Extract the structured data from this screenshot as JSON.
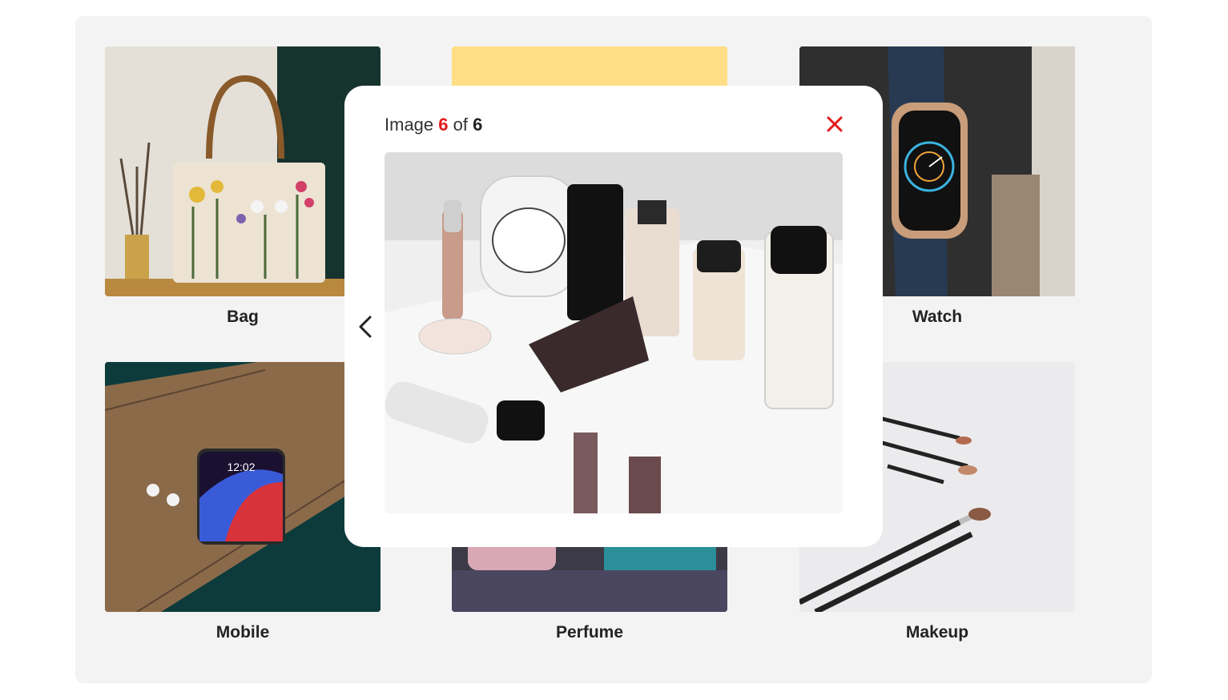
{
  "gallery": {
    "items": [
      {
        "label": "Bag",
        "icon": "bag-photo"
      },
      {
        "label": "",
        "icon": "food-photo"
      },
      {
        "label": "Watch",
        "icon": "watch-photo"
      },
      {
        "label": "Mobile",
        "icon": "mobile-photo"
      },
      {
        "label": "Perfume",
        "icon": "perfume-photo"
      },
      {
        "label": "Makeup",
        "icon": "makeup-photo"
      }
    ]
  },
  "lightbox": {
    "counter_prefix": "Image",
    "current": "6",
    "counter_middle": "of",
    "total": "6",
    "close_icon": "close-icon",
    "prev_icon": "chevron-left-icon",
    "image_icon": "makeup-products-photo",
    "accent_color": "#e01b1b"
  }
}
